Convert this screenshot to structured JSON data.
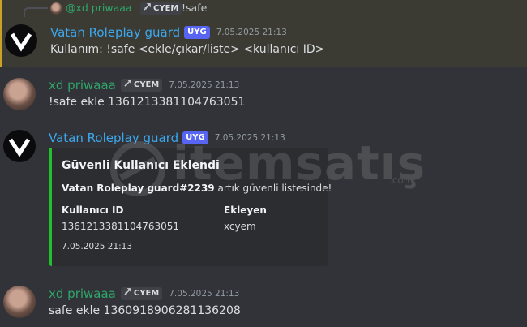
{
  "messages": [
    {
      "reply": {
        "author": "@xd priwaaa",
        "tag": "CYEM",
        "text": "!safe"
      },
      "author": "Vatan Roleplay guard",
      "app_badge": "UYG",
      "timestamp": "7.05.2025 21:13",
      "content": "Kullanım: !safe <ekle/çıkar/liste> <kullanıcı ID>"
    },
    {
      "author": "xd priwaaa",
      "guild_tag": "CYEM",
      "timestamp": "7.05.2025 21:13",
      "content": "!safe ekle 1361213381104763051"
    },
    {
      "author": "Vatan Roleplay guard",
      "app_badge": "UYG",
      "timestamp": "7.05.2025 21:13",
      "embed": {
        "title": "Güvenli Kullanıcı Eklendi",
        "desc_bold": "Vatan Roleplay guard#2239",
        "desc_rest": " artık güvenli listesinde!",
        "fields": [
          {
            "name": "Kullanıcı ID",
            "value": "1361213381104763051"
          },
          {
            "name": "Ekleyen",
            "value": "xcyem"
          }
        ],
        "footer": "7.05.2025 21:13",
        "color": "#23c02d"
      }
    },
    {
      "author": "xd priwaaa",
      "guild_tag": "CYEM",
      "timestamp": "7.05.2025 21:13",
      "content": "safe ekle 1360918906281136208"
    }
  ],
  "watermark": {
    "text": "itemsatış",
    "suffix": ".com"
  },
  "colors": {
    "bot_name": "#3ca9ef",
    "user_name": "#2fa66a",
    "app_badge": "#5865f2",
    "highlight_bar": "#c9a227"
  }
}
